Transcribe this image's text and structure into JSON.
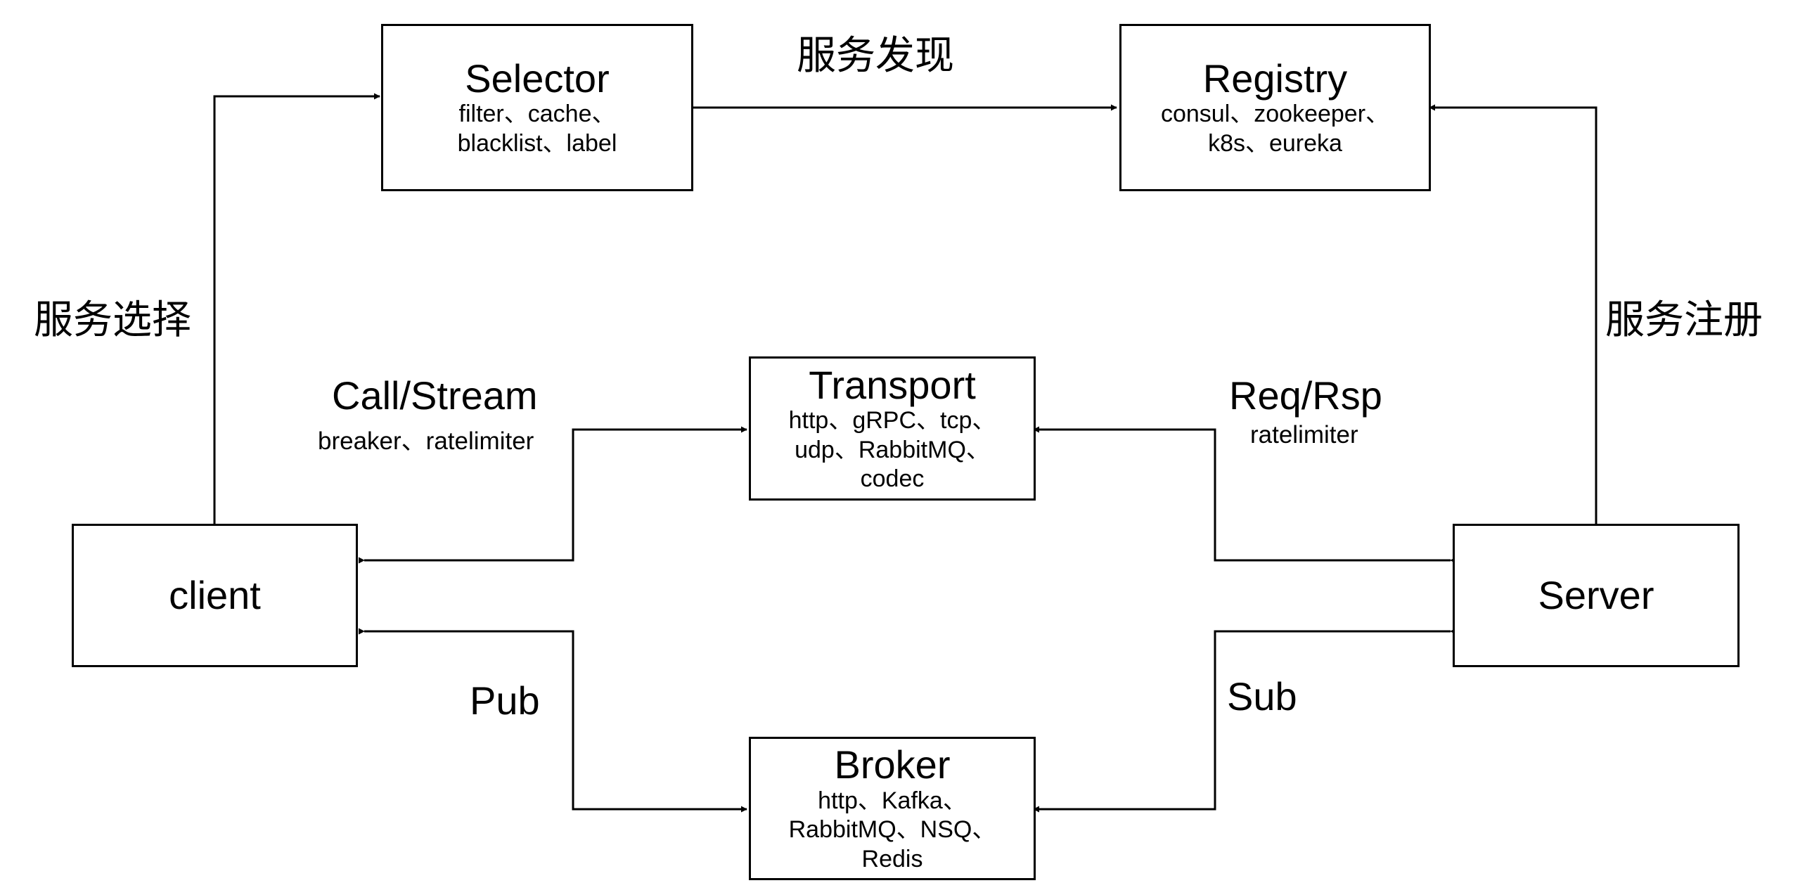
{
  "nodes": {
    "selector": {
      "title": "Selector",
      "line1": "filter、cache、",
      "line2": "blacklist、label"
    },
    "registry": {
      "title": "Registry",
      "line1": "consul、zookeeper、",
      "line2": "k8s、eureka"
    },
    "transport": {
      "title": "Transport",
      "line1": "http、gRPC、tcp、",
      "line2": "udp、RabbitMQ、",
      "line3": "codec"
    },
    "broker": {
      "title": "Broker",
      "line1": "http、Kafka、",
      "line2": "RabbitMQ、NSQ、",
      "line3": "Redis"
    },
    "client": {
      "title": "client"
    },
    "server": {
      "title": "Server"
    }
  },
  "labels": {
    "discovery": "服务发现",
    "selection": "服务选择",
    "registration": "服务注册",
    "call_stream": "Call/Stream",
    "call_stream_sub": "breaker、ratelimiter",
    "req_rsp": "Req/Rsp",
    "req_rsp_sub": "ratelimiter",
    "pub": "Pub",
    "sub": "Sub"
  },
  "colors": {
    "stroke": "#000000",
    "background": "#ffffff"
  }
}
